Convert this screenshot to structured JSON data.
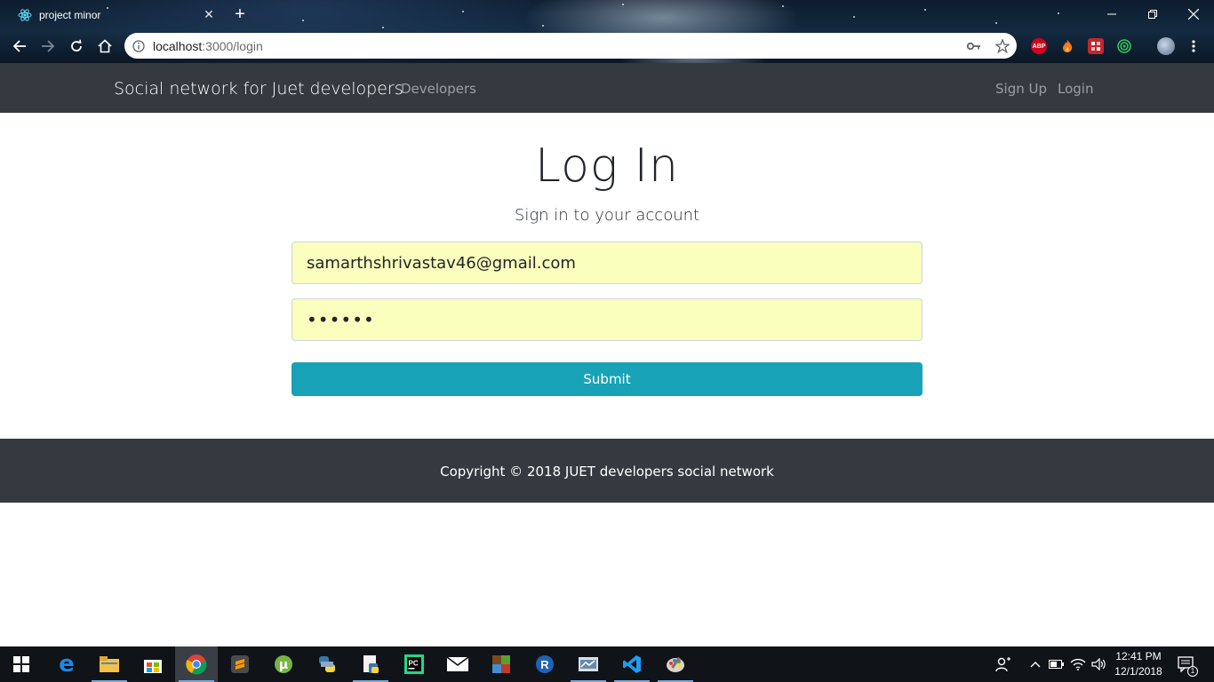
{
  "browser": {
    "tab_title": "project minor",
    "url_host": "localhost",
    "url_rest": ":3000/login",
    "tab_close_glyph": "✕",
    "new_tab_glyph": "+"
  },
  "navbar": {
    "brand": "Social network for Juet developers",
    "links": [
      "Developers",
      "Sign Up",
      "Login"
    ]
  },
  "login": {
    "title": "Log In",
    "subtitle": "Sign in to your account",
    "email_value": "samarthshrivastav46@gmail.com",
    "password_value": "••••••",
    "submit_label": "Submit"
  },
  "footer": {
    "text": "Copyright © 2018 JUET developers social network"
  },
  "taskbar": {
    "time": "12:41 PM",
    "date": "12/1/2018",
    "notification_count": "1",
    "apps": [
      "windows-start",
      "edge",
      "file-explorer",
      "microsoft-store",
      "chrome",
      "sublime-text",
      "utorrent",
      "python",
      "notepad-python",
      "pycharm",
      "mail",
      "minecraft",
      "r",
      "vlc-like",
      "vscode",
      "paint"
    ]
  },
  "colors": {
    "navbar_bg": "#343a40",
    "autofill_bg": "#faffbd",
    "submit_bg": "#17a2b8",
    "taskbar_bg": "#101318"
  }
}
